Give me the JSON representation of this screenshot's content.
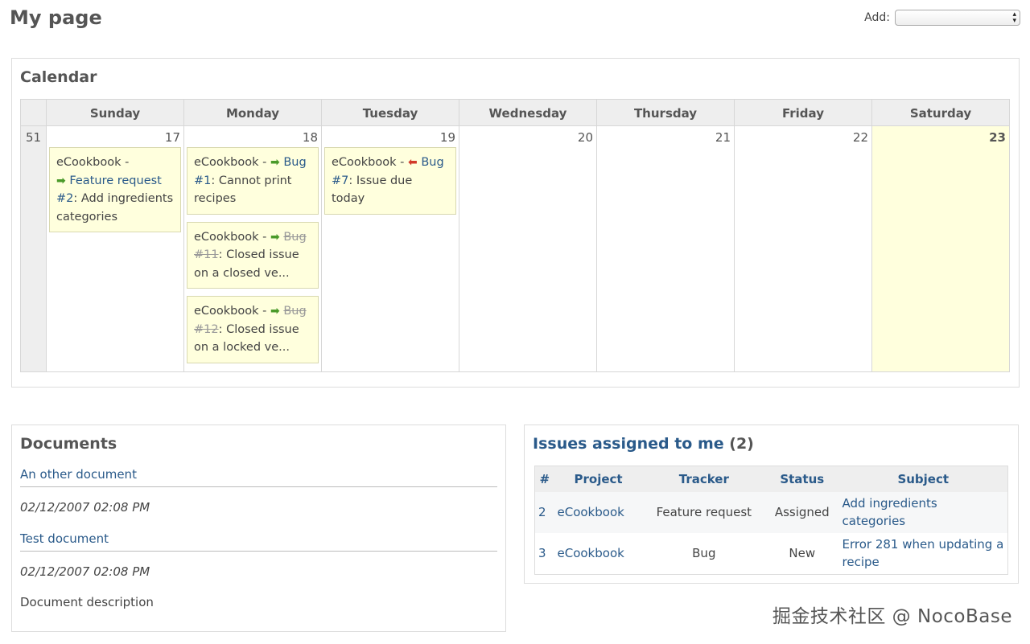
{
  "page": {
    "title": "My page"
  },
  "add": {
    "label": "Add:",
    "selected": ""
  },
  "calendar": {
    "title": "Calendar",
    "week_number": "51",
    "days": [
      "Sunday",
      "Monday",
      "Tuesday",
      "Wednesday",
      "Thursday",
      "Friday",
      "Saturday"
    ],
    "dates": [
      "17",
      "18",
      "19",
      "20",
      "21",
      "22",
      "23"
    ],
    "events": {
      "sun": [
        {
          "project": "eCookbook -",
          "tracker": "Feature request",
          "id": "#2",
          "subject": ": Add ingredients categories",
          "arrow": "start",
          "closed": false
        }
      ],
      "mon": [
        {
          "project": "eCookbook -",
          "tracker": "Bug",
          "id": "#1",
          "subject": ": Cannot print recipes",
          "arrow": "start",
          "closed": false
        },
        {
          "project": "eCookbook -",
          "tracker": "Bug",
          "id": "#11",
          "subject": ": Closed issue on a closed ve...",
          "arrow": "start",
          "closed": true
        },
        {
          "project": "eCookbook -",
          "tracker": "Bug",
          "id": "#12",
          "subject": ": Closed issue on a locked ve...",
          "arrow": "start",
          "closed": true
        }
      ],
      "tue": [
        {
          "project": "eCookbook -",
          "tracker": "Bug",
          "id": "#7",
          "subject": ": Issue due today",
          "arrow": "end",
          "closed": false
        }
      ]
    }
  },
  "documents": {
    "title": "Documents",
    "items": [
      {
        "title": "An other document",
        "date": "02/12/2007 02:08 PM"
      },
      {
        "title": "Test document",
        "date": "02/12/2007 02:08 PM"
      }
    ],
    "description": "Document description"
  },
  "issues": {
    "title": "Issues assigned to me",
    "count": "(2)",
    "headers": [
      "#",
      "Project",
      "Tracker",
      "Status",
      "Subject"
    ],
    "rows": [
      {
        "id": "2",
        "project": "eCookbook",
        "tracker": "Feature request",
        "status": "Assigned",
        "subject": "Add ingredients categories"
      },
      {
        "id": "3",
        "project": "eCookbook",
        "tracker": "Bug",
        "status": "New",
        "subject": "Error 281 when updating a recipe"
      }
    ]
  },
  "watermark": "掘金技术社区 @ NocoBase",
  "icons": {
    "arrow_start": "arrow-right-green-icon",
    "arrow_end": "arrow-left-red-icon"
  },
  "colors": {
    "link": "#2a5a8a",
    "today_bg": "#ffffdd",
    "header_bg": "#eeeeee"
  }
}
